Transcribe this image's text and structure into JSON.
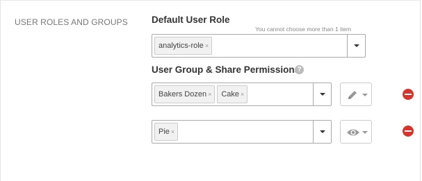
{
  "section": {
    "title": "USER ROLES AND GROUPS"
  },
  "default_role": {
    "label": "Default User Role",
    "hint": "You cannot choose more than 1 item",
    "selected": [
      {
        "label": "analytics-role",
        "remove_glyph": "×"
      }
    ]
  },
  "groups": {
    "label": "User Group & Share Permissions",
    "help_icon": "question-circle-icon",
    "help_glyph": "?",
    "rows": [
      {
        "selected": [
          {
            "label": "Bakers Dozen",
            "remove_glyph": "×"
          },
          {
            "label": "Cake",
            "remove_glyph": "×"
          }
        ],
        "permission_icon": "pencil-icon",
        "remove_icon": "minus-circle-icon"
      },
      {
        "selected": [
          {
            "label": "Pie",
            "remove_glyph": "×"
          }
        ],
        "permission_icon": "eye-icon",
        "remove_icon": "minus-circle-icon"
      }
    ]
  },
  "colors": {
    "remove": "#d9342b",
    "icon_gray": "#999999"
  }
}
